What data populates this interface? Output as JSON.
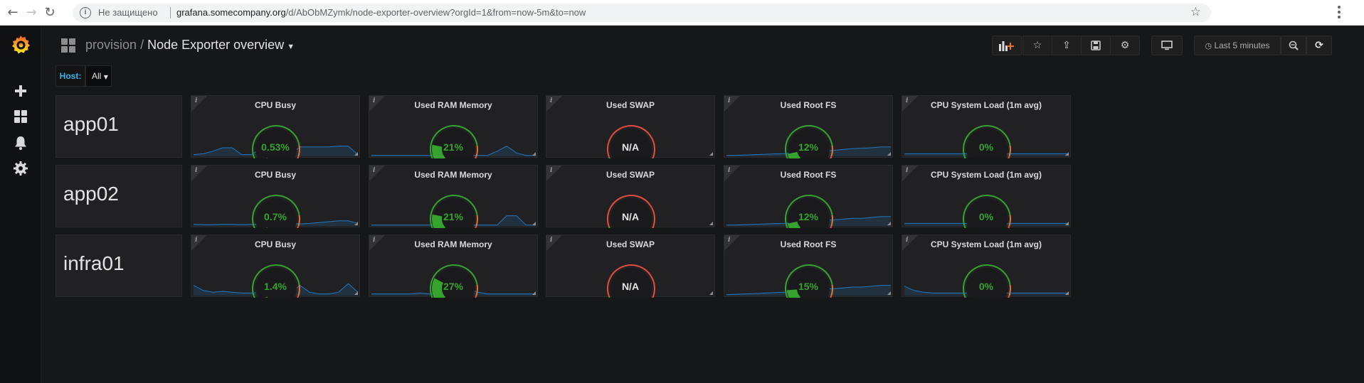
{
  "browser": {
    "security_label": "Не защищено",
    "url_host": "grafana.somecompany.org",
    "url_path": "/d/AbObMZymk/node-exporter-overview?orgId=1&from=now-5m&to=now"
  },
  "dashboard": {
    "folder": "provision",
    "separator": "/",
    "title": "Node Exporter overview",
    "time_range": "Last 5 minutes"
  },
  "variables": {
    "host_label": "Host:",
    "host_value": "All"
  },
  "colors": {
    "ok": "#37a32f",
    "warn": "#e0752d",
    "crit": "#e24d42",
    "sparkline": "#1f78c1",
    "value_text": "#37a32f",
    "na_text": "#e3e3e3"
  },
  "panel_titles": [
    "CPU Busy",
    "Used RAM Memory",
    "Used SWAP",
    "Used Root FS",
    "CPU System Load (1m avg)"
  ],
  "rows": [
    {
      "host": "app01",
      "panels": [
        {
          "title": "CPU Busy",
          "value": "0.53%",
          "fraction": 0.0053,
          "spark": [
            0.1,
            0.15,
            0.3,
            0.5,
            0.5,
            0.1,
            0.1,
            0.5,
            0.5,
            0.15,
            0.1,
            0.55,
            0.55,
            0.55,
            0.55,
            0.6,
            0.6,
            0.1
          ]
        },
        {
          "title": "Used RAM Memory",
          "value": "21%",
          "fraction": 0.21,
          "spark": [
            0.05,
            0.05,
            0.05,
            0.05,
            0.05,
            0.05,
            0.05,
            0.05,
            0.05,
            0.55,
            0.05,
            0.05,
            0.05,
            0.3,
            0.6,
            0.2,
            0.05,
            0.05
          ]
        },
        {
          "title": "Used SWAP",
          "value": "N/A",
          "fraction": null,
          "spark": null
        },
        {
          "title": "Used Root FS",
          "value": "12%",
          "fraction": 0.12,
          "spark": [
            0.05,
            0.06,
            0.08,
            0.1,
            0.12,
            0.14,
            0.16,
            0.2,
            0.22,
            0.25,
            0.3,
            0.35,
            0.4,
            0.45,
            0.48,
            0.5,
            0.55,
            0.55
          ]
        },
        {
          "title": "CPU System Load (1m avg)",
          "value": "0%",
          "fraction": 0.0,
          "spark": [
            0.15,
            0.15,
            0.15,
            0.15,
            0.15,
            0.15,
            0.15,
            0.15,
            0.15,
            0.15,
            0.15,
            0.15,
            0.15,
            0.15,
            0.15,
            0.15,
            0.15,
            0.15
          ]
        }
      ]
    },
    {
      "host": "app02",
      "panels": [
        {
          "title": "CPU Busy",
          "value": "0.7%",
          "fraction": 0.007,
          "spark": [
            0.1,
            0.08,
            0.08,
            0.1,
            0.1,
            0.08,
            0.1,
            0.1,
            0.12,
            0.12,
            0.15,
            0.12,
            0.15,
            0.2,
            0.25,
            0.3,
            0.3,
            0.15
          ]
        },
        {
          "title": "Used RAM Memory",
          "value": "21%",
          "fraction": 0.21,
          "spark": [
            0.05,
            0.05,
            0.05,
            0.05,
            0.05,
            0.05,
            0.05,
            0.05,
            0.05,
            0.05,
            0.05,
            0.05,
            0.05,
            0.05,
            0.6,
            0.6,
            0.05,
            0.05
          ]
        },
        {
          "title": "Used SWAP",
          "value": "N/A",
          "fraction": null,
          "spark": null
        },
        {
          "title": "Used Root FS",
          "value": "12%",
          "fraction": 0.12,
          "spark": [
            0.05,
            0.06,
            0.08,
            0.1,
            0.12,
            0.14,
            0.15,
            0.2,
            0.25,
            0.3,
            0.35,
            0.35,
            0.4,
            0.45,
            0.45,
            0.5,
            0.55,
            0.55
          ]
        },
        {
          "title": "CPU System Load (1m avg)",
          "value": "0%",
          "fraction": 0.0,
          "spark": [
            0.15,
            0.15,
            0.15,
            0.15,
            0.15,
            0.15,
            0.15,
            0.15,
            0.15,
            0.15,
            0.15,
            0.15,
            0.15,
            0.15,
            0.15,
            0.15,
            0.15,
            0.15
          ]
        }
      ]
    },
    {
      "host": "infra01",
      "panels": [
        {
          "title": "CPU Busy",
          "value": "1.4%",
          "fraction": 0.014,
          "spark": [
            0.6,
            0.3,
            0.2,
            0.25,
            0.2,
            0.15,
            0.15,
            0.2,
            0.2,
            0.2,
            0.15,
            0.6,
            0.2,
            0.1,
            0.1,
            0.2,
            0.7,
            0.2
          ]
        },
        {
          "title": "Used RAM Memory",
          "value": "27%",
          "fraction": 0.27,
          "spark": [
            0.1,
            0.1,
            0.1,
            0.1,
            0.1,
            0.15,
            0.1,
            0.1,
            0.1,
            0.1,
            0.4,
            0.2,
            0.1,
            0.1,
            0.1,
            0.1,
            0.1,
            0.1
          ]
        },
        {
          "title": "Used SWAP",
          "value": "N/A",
          "fraction": null,
          "spark": null
        },
        {
          "title": "Used Root FS",
          "value": "15%",
          "fraction": 0.15,
          "spark": [
            0.05,
            0.08,
            0.1,
            0.12,
            0.15,
            0.18,
            0.2,
            0.25,
            0.3,
            0.35,
            0.4,
            0.4,
            0.45,
            0.5,
            0.5,
            0.55,
            0.6,
            0.6
          ]
        },
        {
          "title": "CPU System Load (1m avg)",
          "value": "0%",
          "fraction": 0.0,
          "spark": [
            0.55,
            0.3,
            0.2,
            0.15,
            0.15,
            0.15,
            0.15,
            0.15,
            0.15,
            0.15,
            0.15,
            0.15,
            0.15,
            0.15,
            0.15,
            0.15,
            0.15,
            0.15
          ]
        }
      ]
    }
  ]
}
